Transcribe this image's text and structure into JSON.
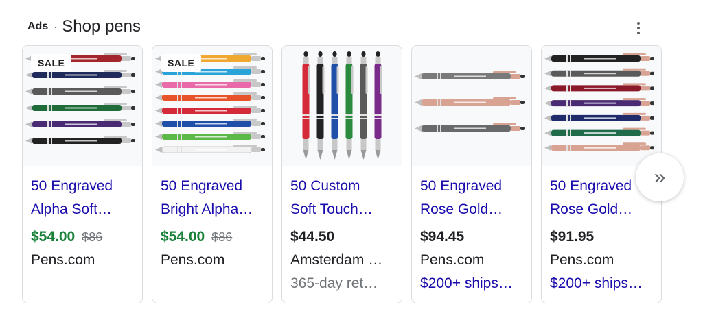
{
  "header": {
    "ads_label": "Ads",
    "separator": "·",
    "title": "Shop pens",
    "menu_icon": "more-vert-icon"
  },
  "next_button": {
    "icon": "double-chevron-right-icon",
    "glyph": "»"
  },
  "products": [
    {
      "badge": "SALE",
      "title_line1": "50 Engraved",
      "title_line2": "Alpha Soft…",
      "price": "$54.00",
      "original_price": "$86",
      "merchant": "Pens.com",
      "extra": "",
      "on_sale": true,
      "pen_colors": [
        "#a3262c",
        "#1f2b5a",
        "#5a5a5a",
        "#1f6b3a",
        "#4a2a72",
        "#222222"
      ]
    },
    {
      "badge": "SALE",
      "title_line1": "50 Engraved",
      "title_line2": "Bright Alpha…",
      "price": "$54.00",
      "original_price": "$86",
      "merchant": "Pens.com",
      "extra": "",
      "on_sale": true,
      "pen_colors": [
        "#f0a830",
        "#2aa3d8",
        "#e86aa8",
        "#e8542a",
        "#d42a3a",
        "#1f4fa8",
        "#5cb848",
        "#f2f2f2"
      ]
    },
    {
      "badge": "",
      "title_line1": "50 Custom",
      "title_line2": "Soft Touch…",
      "price": "$44.50",
      "original_price": "",
      "merchant": "Amsterdam …",
      "extra": "365-day ret…",
      "extra_style": "grey",
      "on_sale": false,
      "pen_colors": [
        "#d42a3a",
        "#222222",
        "#1f4fa8",
        "#2a8a3e",
        "#5a5a5a",
        "#7a2a8a"
      ]
    },
    {
      "badge": "",
      "title_line1": "50 Engraved",
      "title_line2": "Rose Gold…",
      "price": "$94.45",
      "original_price": "",
      "merchant": "Pens.com",
      "extra": "$200+ ships…",
      "extra_style": "blue",
      "on_sale": false,
      "pen_colors": [
        "#7a7a7a",
        "#d9a394",
        "#6a6a6a"
      ]
    },
    {
      "badge": "",
      "title_line1": "50 Engraved",
      "title_line2": "Rose Gold…",
      "price": "$91.95",
      "original_price": "",
      "merchant": "Pens.com",
      "extra": "$200+ ships…",
      "extra_style": "blue",
      "on_sale": false,
      "pen_colors": [
        "#222222",
        "#5a5a5a",
        "#8a1a2a",
        "#4a2a72",
        "#1f2b6a",
        "#1f6b4a",
        "#d9a394"
      ]
    }
  ]
}
